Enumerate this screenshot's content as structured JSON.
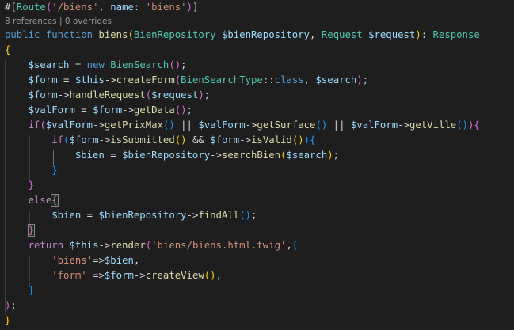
{
  "theme": {
    "background": "#1e1e1e",
    "text": "#d4d4d4",
    "keyword": "#569cd6",
    "control": "#c586c0",
    "function": "#dcdcaa",
    "class": "#4ec9b0",
    "variable": "#9cdcfe",
    "string": "#ce9178",
    "bracket1": "#ffd700",
    "bracket2": "#da70d6",
    "bracket3": "#179fff"
  },
  "codelens": {
    "references": "8 references",
    "separator": " | ",
    "overrides": "0 overrides"
  },
  "code": {
    "attr_open": "#[",
    "attr_name": "Route",
    "attr_paren_open": "(",
    "route_path": "'/biens'",
    "attr_comma": ", ",
    "attr_named_key": "name",
    "attr_colon": ": ",
    "route_name": "'biens'",
    "attr_paren_close": ")",
    "attr_close": "]",
    "kw_public": "public",
    "kw_function": "function",
    "fn_name": "biens",
    "sig_paren_open": "(",
    "param1_type": "BienRepository",
    "param1_var": "$bienRepository",
    "param_comma": ", ",
    "param2_type": "Request",
    "param2_var": "$request",
    "sig_paren_close": ")",
    "ret_colon": ": ",
    "ret_type": "Response",
    "brace_open": "{",
    "l4_var": "$search",
    "eq": " = ",
    "kw_new": "new",
    "l4_class": "BienSearch",
    "l4_parens": "()",
    "semi": ";",
    "l5_var": "$form",
    "this": "$this",
    "arrow": "->",
    "l5_fn": "createForm",
    "l5_po": "(",
    "l5_class": "BienSearchType",
    "dcolon": "::",
    "l5_const": "class",
    "l5_arg2": "$search",
    "l5_pc": ")",
    "l6_var": "$form",
    "l6_fn": "handleRequest",
    "l6_po": "(",
    "l6_arg": "$request",
    "l6_pc": ")",
    "l7_var": "$valForm",
    "l7_obj": "$form",
    "l7_fn": "getData",
    "l7_parens": "()",
    "kw_if": "if",
    "l8_po": "(",
    "l8_v1": "$valForm",
    "l8_f1": "getPrixMax",
    "l8_call1": "()",
    "or": " || ",
    "l8_v2": "$valForm",
    "l8_f2": "getSurface",
    "l8_call2": "()",
    "l8_v3": "$valForm",
    "l8_f3": "getVille",
    "l8_call3": "()",
    "l8_pc": ")",
    "l8_brace": "{",
    "l9_po": "(",
    "l9_v1": "$form",
    "l9_f1": "isSubmitted",
    "l9_call1": "()",
    "and": " && ",
    "l9_v2": "$form",
    "l9_f2": "isValid",
    "l9_call2": "()",
    "l9_pc": ")",
    "l9_brace": "{",
    "l10_var": "$bien",
    "l10_obj": "$bienRepository",
    "l10_fn": "searchBien",
    "l10_po": "(",
    "l10_arg": "$search",
    "l10_pc": ")",
    "l11_brace": "}",
    "l12_brace": "}",
    "kw_else": "else",
    "l13_brace": "{",
    "l14_var": "$bien",
    "l14_obj": "$bienRepository",
    "l14_fn": "findAll",
    "l14_parens": "()",
    "l15_brace": "}",
    "kw_return": "return",
    "l17_this": "$this",
    "l17_fn": "render",
    "l17_po": "(",
    "l17_tpl": "'biens/biens.html.twig'",
    "l17_comma": ",",
    "l17_bo": "[",
    "l18_key": "'biens'",
    "darrow": "=>",
    "l18_val": "$bien",
    "comma": ",",
    "l19_key": "'form'",
    "darrow_sp": " =>",
    "l19_obj": "$form",
    "l19_fn": "createView",
    "l19_parens": "()",
    "l20_bc": "]",
    "l21_pc": ")",
    "l22_brace": "}"
  }
}
